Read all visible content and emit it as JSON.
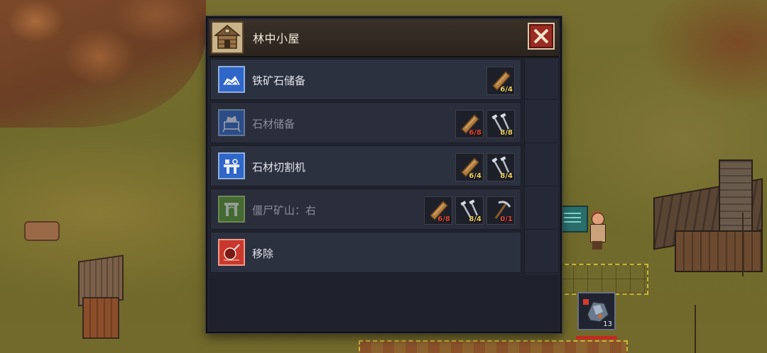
{
  "dialog": {
    "title": "林中小屋",
    "title_icon": "wooden-hut-icon",
    "close_icon": "close-x-icon",
    "items": [
      {
        "label": "铁矿石储备",
        "icon": "ore-stockpile-icon",
        "icon_color": "blue",
        "available": true,
        "costs": [
          {
            "icon": "wood-plank-icon",
            "amount": "6/4",
            "sufficient": true
          }
        ]
      },
      {
        "label": "石材储备",
        "icon": "stone-stockpile-icon",
        "icon_color": "blue",
        "available": false,
        "costs": [
          {
            "icon": "wood-plank-icon",
            "amount": "6/8",
            "sufficient": false
          },
          {
            "icon": "nails-icon",
            "amount": "8/8",
            "sufficient": true
          }
        ]
      },
      {
        "label": "石材切割机",
        "icon": "stone-cutter-icon",
        "icon_color": "blue",
        "available": true,
        "costs": [
          {
            "icon": "wood-plank-icon",
            "amount": "6/4",
            "sufficient": true
          },
          {
            "icon": "nails-icon",
            "amount": "8/4",
            "sufficient": true
          }
        ]
      },
      {
        "label": "僵尸矿山：右",
        "icon": "zombie-mine-icon",
        "icon_color": "green",
        "available": false,
        "costs": [
          {
            "icon": "wood-plank-icon",
            "amount": "6/8",
            "sufficient": false
          },
          {
            "icon": "nails-icon",
            "amount": "8/4",
            "sufficient": true
          },
          {
            "icon": "pickaxe-icon",
            "amount": "0/1",
            "sufficient": false
          }
        ]
      },
      {
        "label": "移除",
        "icon": "remove-wrecking-ball-icon",
        "icon_color": "red",
        "available": true,
        "costs": []
      }
    ]
  },
  "inventory_slot": {
    "icon": "iron-ore-icon",
    "count": "13"
  },
  "colors": {
    "panel_bg": "#20232d",
    "title_bg": "#2b241e",
    "cost_ok": "#f0d060",
    "cost_bad": "#e0483a",
    "close_btn": "#9a2a22"
  }
}
